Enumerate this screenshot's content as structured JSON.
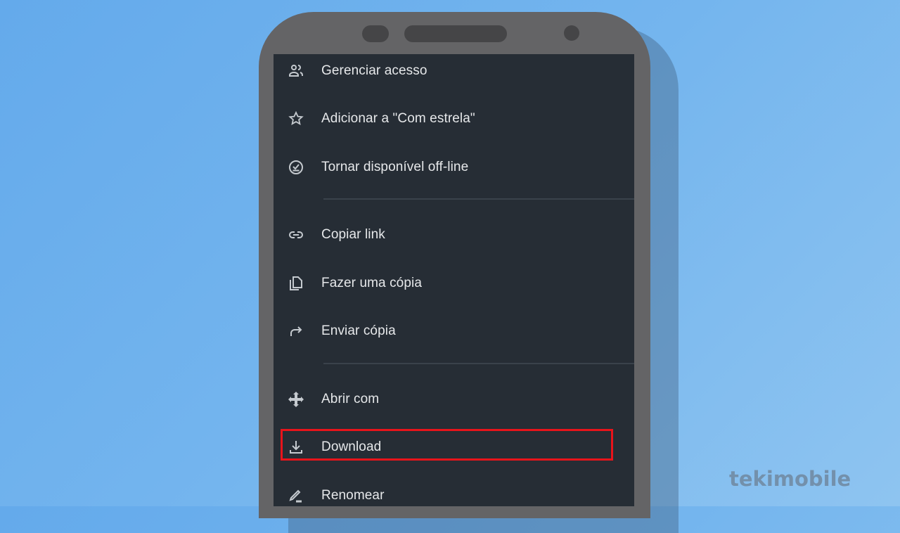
{
  "menu": {
    "items": [
      {
        "label": "Gerenciar acesso",
        "icon": "manage-access-icon"
      },
      {
        "label": "Adicionar a \"Com estrela\"",
        "icon": "star-icon"
      },
      {
        "label": "Tornar disponível off-line",
        "icon": "offline-icon"
      },
      {
        "label": "Copiar link",
        "icon": "link-icon"
      },
      {
        "label": "Fazer uma cópia",
        "icon": "copy-icon"
      },
      {
        "label": "Enviar cópia",
        "icon": "send-icon"
      },
      {
        "label": "Abrir com",
        "icon": "open-with-icon"
      },
      {
        "label": "Download",
        "icon": "download-icon",
        "highlighted": true
      },
      {
        "label": "Renomear",
        "icon": "rename-icon"
      }
    ]
  },
  "highlight_color": "#e8141b",
  "watermark": "tekimobile"
}
